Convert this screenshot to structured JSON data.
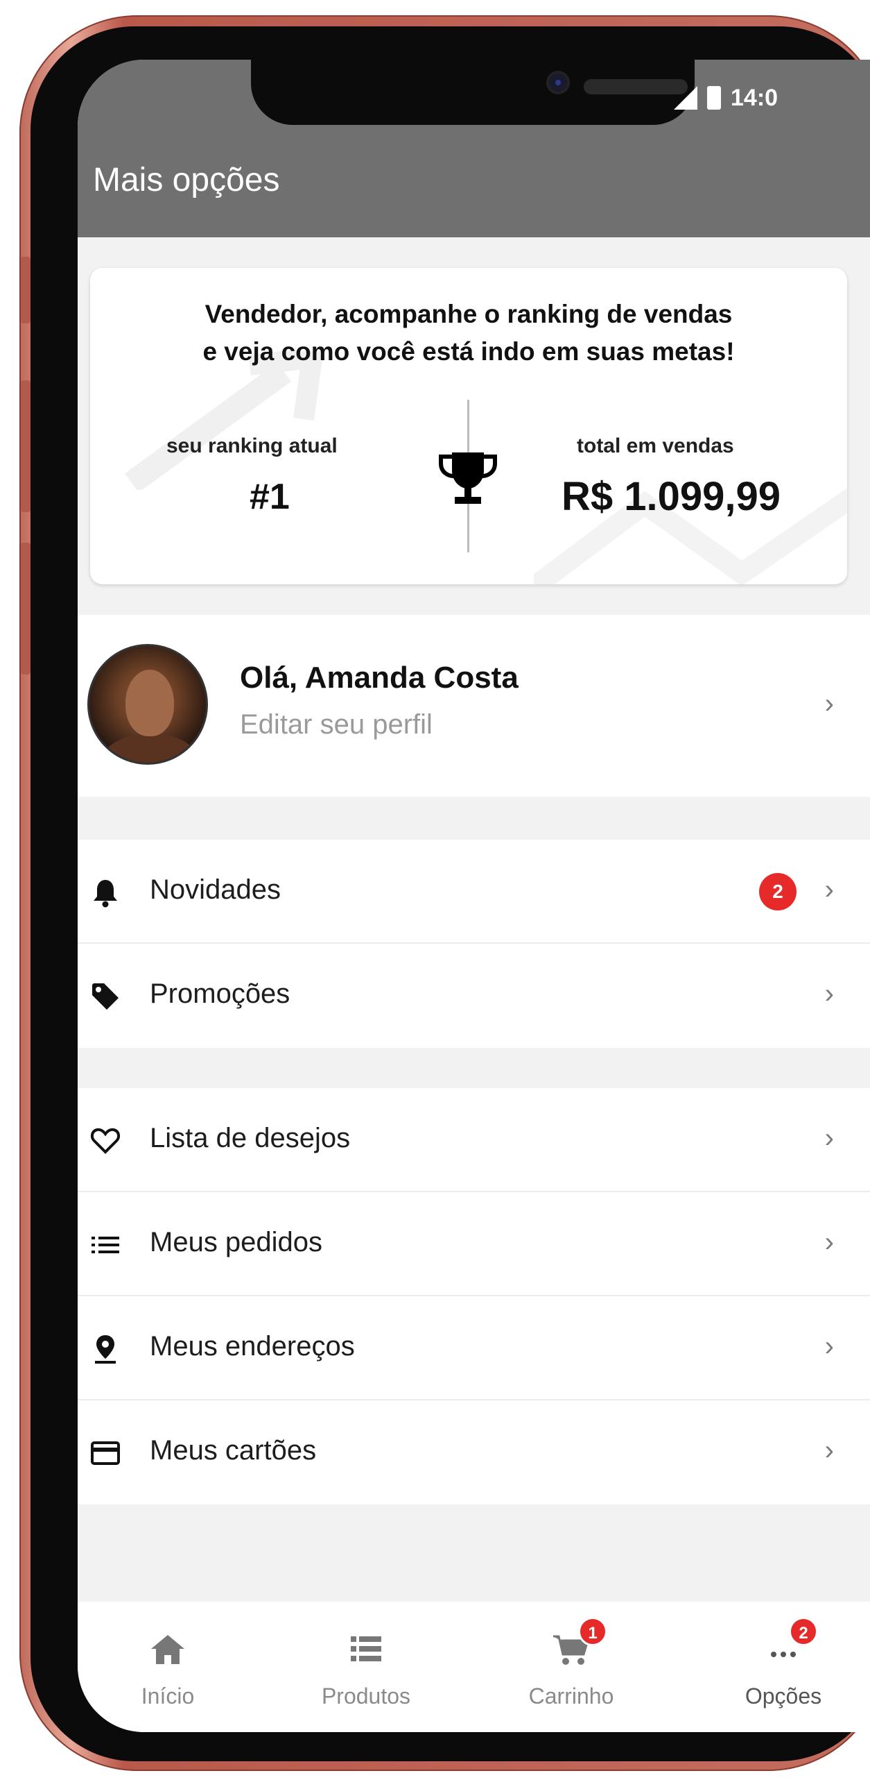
{
  "status_bar": {
    "time": "14:0"
  },
  "header": {
    "title": "Mais opções"
  },
  "ranking_card": {
    "headline_line1": "Vendedor, acompanhe o ranking de vendas",
    "headline_line2": "e veja como você está indo em suas metas!",
    "rank_label": "seu ranking atual",
    "rank_value": "#1",
    "sales_label": "total em vendas",
    "sales_value": "R$ 1.099,99"
  },
  "profile": {
    "greeting": "Olá, Amanda Costa",
    "edit_label": "Editar seu perfil"
  },
  "groups": [
    {
      "items": [
        {
          "label": "Novidades",
          "icon": "bell-icon",
          "badge": "2"
        },
        {
          "label": "Promoções",
          "icon": "tag-icon"
        }
      ]
    },
    {
      "items": [
        {
          "label": "Lista de desejos",
          "icon": "heart-icon"
        },
        {
          "label": "Meus pedidos",
          "icon": "list-icon"
        },
        {
          "label": "Meus endereços",
          "icon": "location-pin-icon"
        },
        {
          "label": "Meus cartões",
          "icon": "credit-card-icon"
        }
      ]
    }
  ],
  "bottom_nav": {
    "items": [
      {
        "label": "Início",
        "icon": "home-icon"
      },
      {
        "label": "Produtos",
        "icon": "list-icon"
      },
      {
        "label": "Carrinho",
        "icon": "cart-icon",
        "badge": "1"
      },
      {
        "label": "Opções",
        "icon": "more-dots-icon",
        "badge": "2"
      }
    ]
  },
  "colors": {
    "header_bg": "#707070",
    "badge": "#e62a2a",
    "frame": "#c06a5c"
  }
}
